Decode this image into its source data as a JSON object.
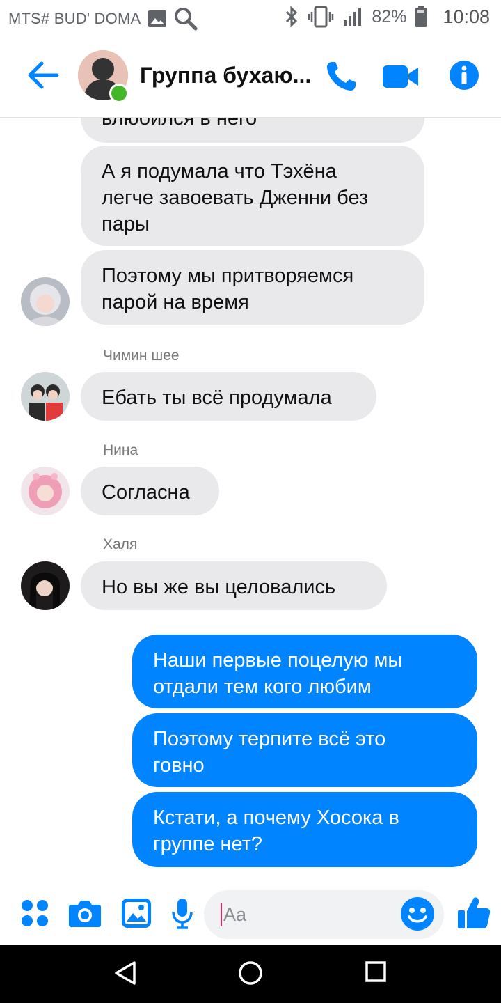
{
  "status_bar": {
    "carrier": "MTS# BUD' DOMA",
    "battery": "82%",
    "time": "10:08"
  },
  "header": {
    "title": "Группа бухаю...",
    "icons": [
      "back-arrow-icon",
      "phone-icon",
      "video-camera-icon",
      "info-icon"
    ]
  },
  "messages": [
    {
      "type": "incoming",
      "text": "влюбился в него"
    },
    {
      "type": "incoming",
      "text": "А я подумала что Тэхёна\nлегче завоевать Дженни без\nпары"
    },
    {
      "type": "incoming",
      "text": "Поэтому мы притворяемся\nпарой на время"
    },
    {
      "type": "sender",
      "text": "Чимин шее"
    },
    {
      "type": "incoming",
      "text": "Ебать ты всё продумала"
    },
    {
      "type": "sender",
      "text": "Нина"
    },
    {
      "type": "incoming",
      "text": "Согласна"
    },
    {
      "type": "sender",
      "text": "Халя"
    },
    {
      "type": "incoming",
      "text": "Но вы же вы целовались"
    },
    {
      "type": "outgoing",
      "text": "Наши первые поцелую мы\nотдали тем кого любим"
    },
    {
      "type": "outgoing",
      "text": "Поэтому терпите всё это\nговно"
    },
    {
      "type": "outgoing",
      "text": "Кстати, а почему Хосока в\nгруппе нет?"
    }
  ],
  "composer": {
    "placeholder": "Aa",
    "icons": [
      "apps-grid-icon",
      "camera-icon",
      "gallery-icon",
      "microphone-icon",
      "emoji-icon",
      "thumbs-up-icon"
    ]
  },
  "colors": {
    "accent": "#0084ff",
    "incoming_bubble": "#e9e9eb",
    "online": "#42b72a"
  }
}
